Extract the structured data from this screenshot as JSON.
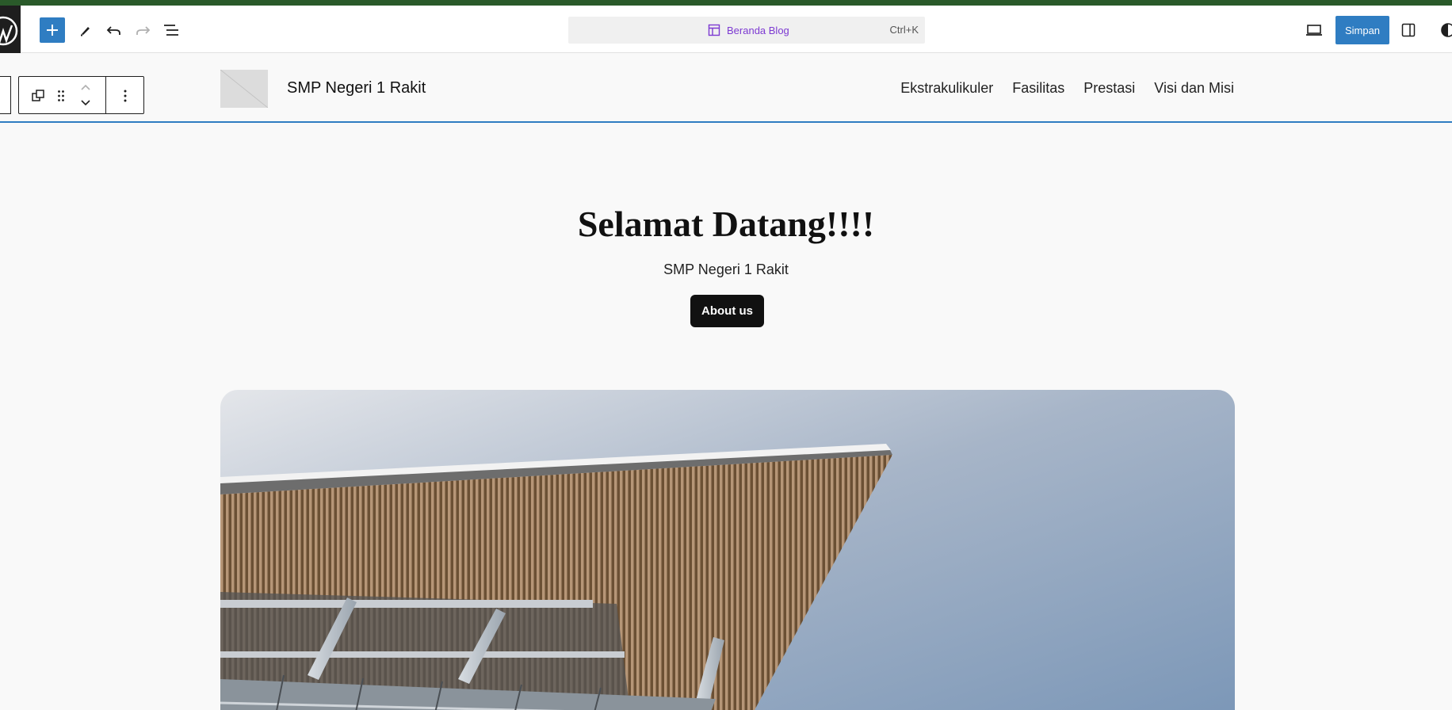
{
  "editor": {
    "command_title": "Beranda Blog",
    "command_shortcut": "Ctrl+K",
    "save_label": "Simpan",
    "accent_color": "#2f7dc2",
    "command_color": "#7d3ad2"
  },
  "site": {
    "title": "SMP Negeri 1 Rakit",
    "nav": [
      "Ekstrakulikuler",
      "Fasilitas",
      "Prestasi",
      "Visi dan Misi"
    ]
  },
  "hero": {
    "heading": "Selamat Datang!!!!",
    "subheading": "SMP Negeri 1 Rakit",
    "button_label": "About us"
  },
  "icons": {
    "toolbar": [
      "wordpress-icon",
      "plus-icon",
      "pencil-icon",
      "undo-icon",
      "redo-icon",
      "list-view-icon",
      "layout-icon",
      "desktop-preview-icon",
      "sidebar-icon",
      "styles-icon"
    ],
    "block_toolbar": [
      "duplicate-icon",
      "drag-handle-icon",
      "chevron-up-icon",
      "chevron-down-icon",
      "more-options-icon"
    ]
  }
}
